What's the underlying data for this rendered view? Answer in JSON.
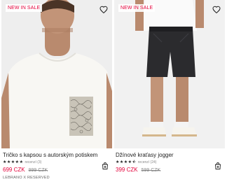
{
  "products": [
    {
      "badge": "NEW IN SALE",
      "title": "Tričko s kapsou s autorským potiskem",
      "rating": 5,
      "rating_count": "recenzí (3)",
      "price": "699 CZK",
      "old_price": "999 CZK",
      "brand": "LEBRANO X RESERVED"
    },
    {
      "badge": "NEW IN SALE",
      "title": "Džínové kraťasy jogger",
      "rating": 4.5,
      "rating_count": "recenzí (24)",
      "price": "399 CZK",
      "old_price": "599 CZK",
      "brand": ""
    }
  ],
  "icons": {
    "wishlist": "heart-icon",
    "cart": "add-to-cart-icon",
    "star": "star-icon"
  },
  "colors": {
    "sale_red": "#e4003a",
    "text": "#222222",
    "muted": "#888888"
  }
}
